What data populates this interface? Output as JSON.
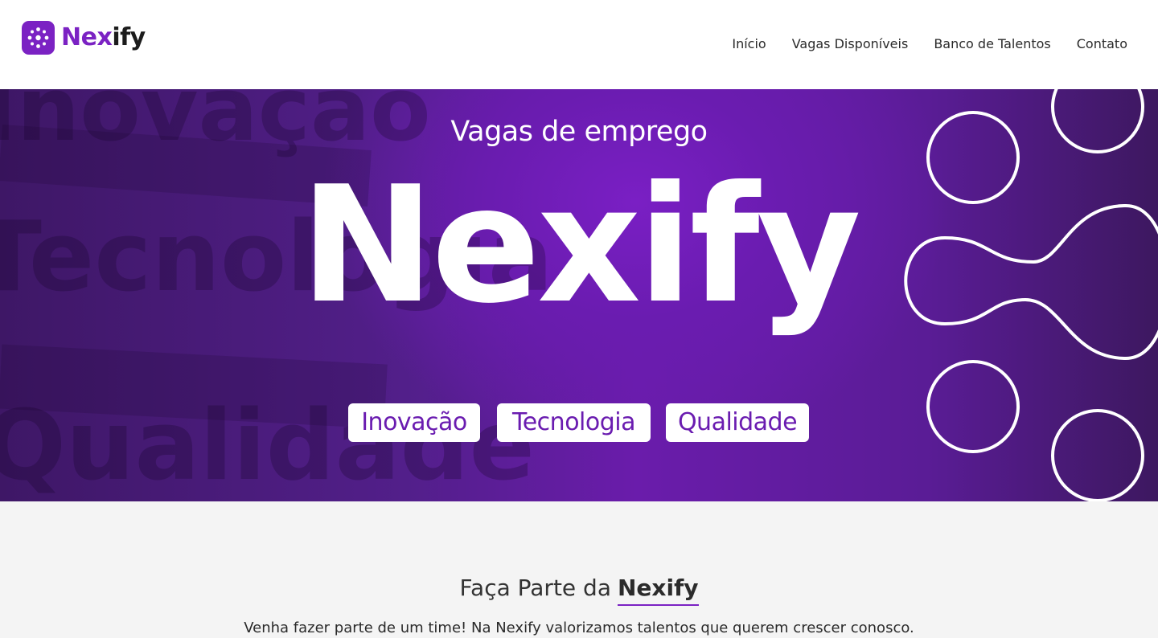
{
  "header": {
    "logo": {
      "part1": "Nex",
      "part2": "ify",
      "icon": "network-dots-icon"
    },
    "nav": [
      {
        "label": "Início"
      },
      {
        "label": "Vagas Disponíveis"
      },
      {
        "label": "Banco de Talentos"
      },
      {
        "label": "Contato"
      }
    ]
  },
  "hero": {
    "subtitle": "Vagas de emprego",
    "title": "Nexify",
    "pills": [
      "Inovação",
      "Tecnologia",
      "Qualidade"
    ],
    "background_words": [
      "Inovação",
      "Tecnologia",
      "Qualidade"
    ]
  },
  "section": {
    "title_prefix": "Faça Parte da",
    "title_strong": "Nexify",
    "intro": "Venha fazer parte de um time! Na Nexify valorizamos talentos que querem crescer conosco."
  },
  "colors": {
    "brand": "#7b22c3",
    "hero_dark": "#3e1766",
    "page_bg": "#f4f4f4"
  }
}
